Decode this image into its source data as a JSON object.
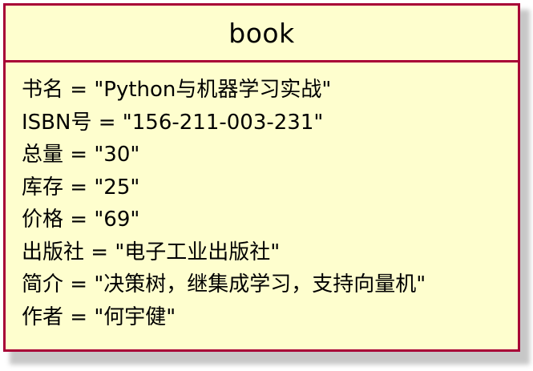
{
  "object": {
    "title": "book",
    "fields": [
      "书名 = \"Python与机器学习实战\"",
      "ISBN号 = \"156-211-003-231\"",
      "总量 = \"30\"",
      "库存 = \"25\"",
      "价格 = \"69\"",
      "出版社 = \"电子工业出版社\"",
      "简介 = \"决策树，继集成学习，支持向量机\"",
      "作者 = \"何宇健\""
    ],
    "colors": {
      "fill": "#fefece",
      "border": "#a80036"
    }
  }
}
